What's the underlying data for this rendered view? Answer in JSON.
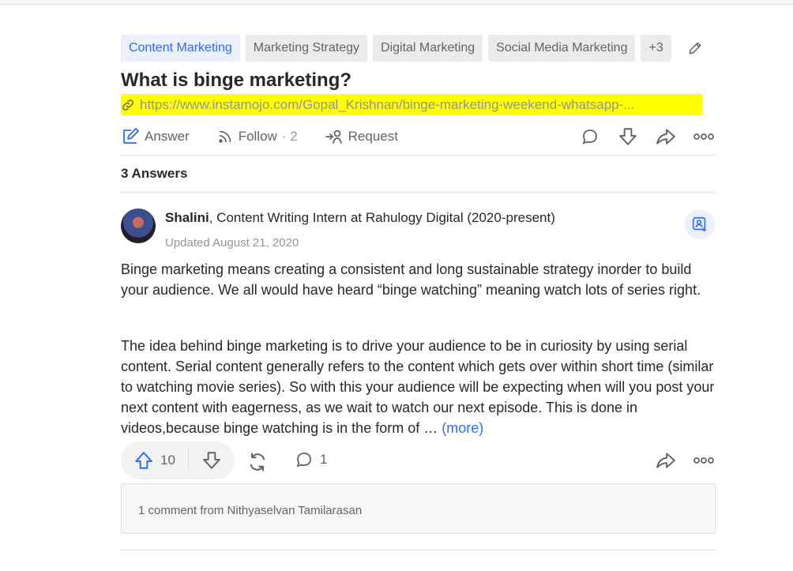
{
  "topics": [
    "Content Marketing",
    "Marketing Strategy",
    "Digital Marketing",
    "Social Media Marketing",
    "+3"
  ],
  "question": {
    "title": "What is binge marketing?",
    "link": "https://www.instamojo.com/Gopal_Krishnan/binge-marketing-weekend-whatsapp-..."
  },
  "actions": {
    "answer": "Answer",
    "follow": "Follow",
    "follow_count": "· 2",
    "request": "Request"
  },
  "answers_count": "3 Answers",
  "answer": {
    "author_name": "Shalini",
    "author_credential": ", Content Writing Intern at Rahulogy Digital (2020-present)",
    "date": "Updated August 21, 2020",
    "para1": "Binge marketing means creating a consistent and long sustainable strategy inorder to build your audience. We all would have heard “binge watching” meaning watch lots of series right.",
    "para2": "The idea behind binge marketing is to drive your audience to be in curiosity by using serial content. Serial content generally refers to the content which gets over within short time (similar to watching movie series). So with this your audience will be expecting when will you post your next content with eagerness, as we wait to watch our next episode. This is done in videos,because binge watching is in the form of … ",
    "more": "(more)",
    "upvotes": "10",
    "comments": "1",
    "comment_preview": "1 comment from Nithyaselvan Tamilarasan"
  },
  "colors": {
    "accent": "#2e69ff",
    "highlight": "#ffff00",
    "text": "#282829",
    "muted": "#636466"
  }
}
